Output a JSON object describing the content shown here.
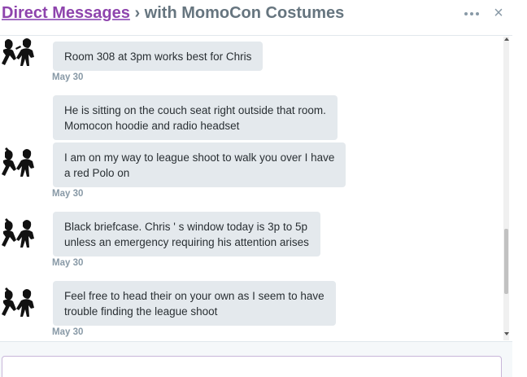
{
  "header": {
    "link_label": "Direct Messages",
    "separator": "›",
    "conversation_title": "with MomoCon Costumes",
    "more_label": "More options",
    "close_label": "×"
  },
  "colors": {
    "link": "#8e44ad",
    "bubble": "#e4e9ed",
    "timestamp": "#8899a6"
  },
  "messages": [
    {
      "text_lines": [
        "Room 308 at 3pm works best for Chris"
      ],
      "timestamp": "May 30",
      "avatar": "costume-silhouette-avatar"
    },
    {
      "text_lines": [
        "He is sitting on the couch seat right outside that room.",
        "Momocon hoodie and radio headset"
      ],
      "timestamp": "",
      "avatar": ""
    },
    {
      "text_lines": [
        "I am on my way to league shoot to walk you over I have",
        "a red Polo on"
      ],
      "timestamp": "May 30",
      "avatar": "costume-silhouette-avatar"
    },
    {
      "text_lines": [
        "Black briefcase. Chris ' s window today is 3p to 5p",
        "unless an emergency requiring his attention arises"
      ],
      "timestamp": "May 30",
      "avatar": "costume-silhouette-avatar"
    },
    {
      "text_lines": [
        "Feel free to head their on your own as I seem to have",
        "trouble finding the league shoot"
      ],
      "timestamp": "May 30",
      "avatar": "costume-silhouette-avatar"
    }
  ],
  "composer": {
    "placeholder": ""
  }
}
